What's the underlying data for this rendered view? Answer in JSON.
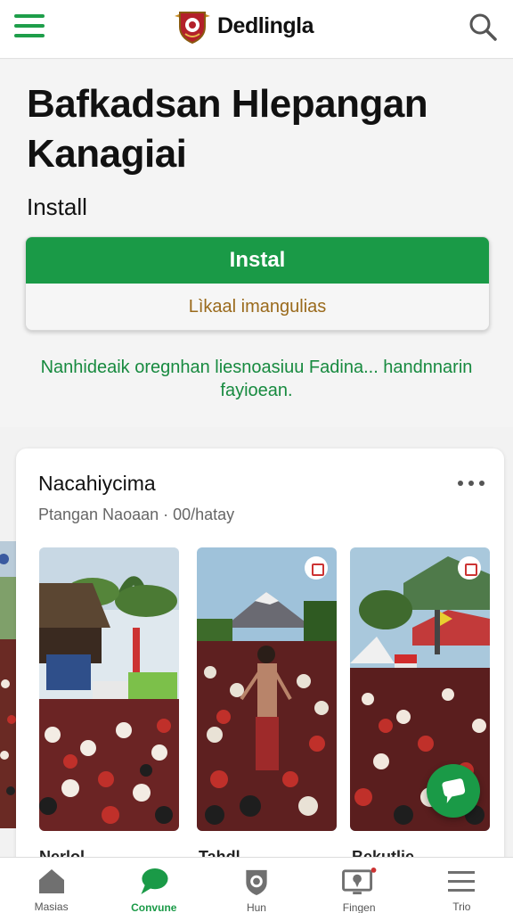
{
  "header": {
    "brand": "Dedlingla",
    "menu_icon": "hamburger-menu-icon",
    "search_icon": "search-icon",
    "logo_icon": "crest-emblem-icon"
  },
  "hero": {
    "title": "Bafkadsan Hlepangan Kanagiai",
    "subtitle": "Install",
    "install_button": "Instal",
    "secondary_link": "Lìkaal imangulias",
    "description": "Nanhideaik oregnhan liesnoasiuu Fadina... handnnarin fayioean."
  },
  "feed": {
    "title": "Nacahiycima",
    "meta": "Ptangan Naoaan ·  00/hatay",
    "items": [
      {
        "label": "Nerlol"
      },
      {
        "label": "Tahdl"
      },
      {
        "label": "Bekutlie"
      }
    ]
  },
  "bottom_nav": [
    {
      "label": "Masias",
      "icon": "home-icon"
    },
    {
      "label": "Convune",
      "icon": "chat-bubble-icon"
    },
    {
      "label": "Hun",
      "icon": "shield-icon"
    },
    {
      "label": "Fingen",
      "icon": "screen-pin-icon"
    },
    {
      "label": "Trio",
      "icon": "menu-lines-icon"
    }
  ],
  "colors": {
    "accent": "#1a9a47",
    "link": "#9a6a1c",
    "description": "#178a3f"
  }
}
